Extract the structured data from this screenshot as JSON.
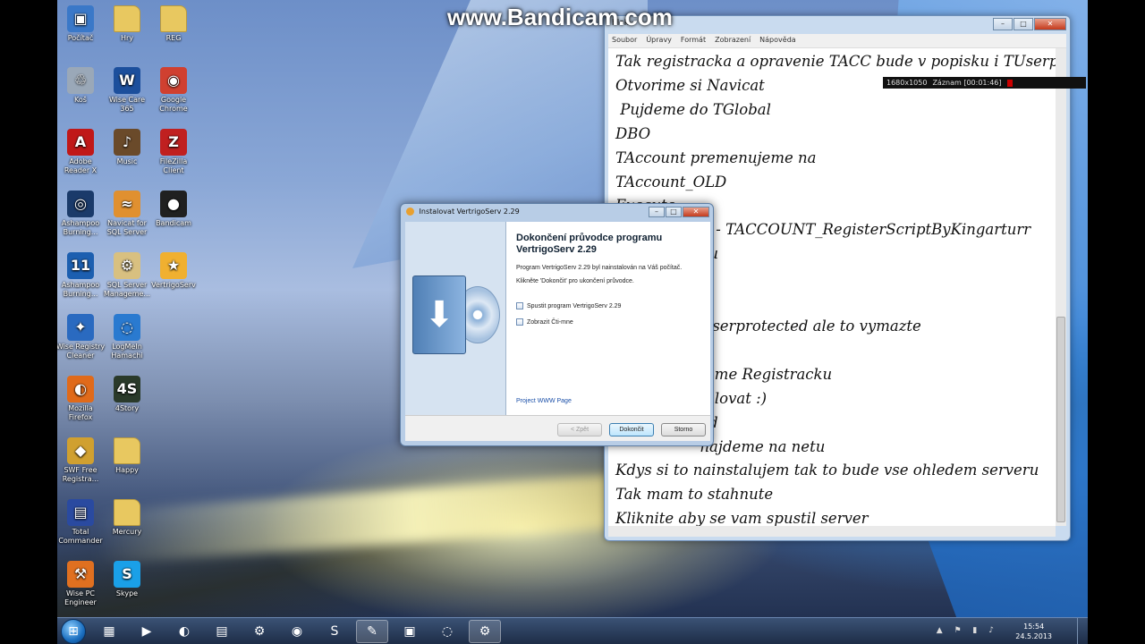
{
  "watermark": "www.Bandicam.com",
  "recorder": {
    "resolution": "1680x1050",
    "status": "Záznam [00:01:46]"
  },
  "desktop_icons": [
    {
      "label": "Počítač",
      "icon": "computer-icon",
      "color": "#3a78c8",
      "glyph": "▣"
    },
    {
      "label": "Hry",
      "icon": "folder-icon",
      "color": "#e8c860",
      "glyph": ""
    },
    {
      "label": "REG",
      "icon": "folder-icon",
      "color": "#e8c860",
      "glyph": ""
    },
    {
      "label": "Koš",
      "icon": "recycle-bin-icon",
      "color": "#9aa8b8",
      "glyph": "♲"
    },
    {
      "label": "Wise Care 365",
      "icon": "wise-care-icon",
      "color": "#1c4f9c",
      "glyph": "W"
    },
    {
      "label": "Google Chrome",
      "icon": "chrome-icon",
      "color": "#d04030",
      "glyph": "◉"
    },
    {
      "label": "Adobe Reader X",
      "icon": "adobe-reader-icon",
      "color": "#c01818",
      "glyph": "A"
    },
    {
      "label": "Music",
      "icon": "music-folder-icon",
      "color": "#6a4a2a",
      "glyph": "♪"
    },
    {
      "label": "FileZilla Client",
      "icon": "filezilla-icon",
      "color": "#c02020",
      "glyph": "Z"
    },
    {
      "label": "Ashampoo Burning...",
      "icon": "ashampoo-icon",
      "color": "#1a3a6a",
      "glyph": "◎"
    },
    {
      "label": "Navicat for SQL Server",
      "icon": "navicat-icon",
      "color": "#e09030",
      "glyph": "≈"
    },
    {
      "label": "Bandicam",
      "icon": "bandicam-icon",
      "color": "#202020",
      "glyph": "●"
    },
    {
      "label": "Ashampoo Burning...",
      "icon": "ashampoo-11-icon",
      "color": "#1c5fb0",
      "glyph": "11"
    },
    {
      "label": "SQL Server Manageme...",
      "icon": "sql-server-icon",
      "color": "#d8c080",
      "glyph": "⚙"
    },
    {
      "label": "VertrigoServ",
      "icon": "vertrigoserv-icon",
      "color": "#f0b030",
      "glyph": "★"
    },
    {
      "label": "Wise Registry Cleaner",
      "icon": "wise-registry-icon",
      "color": "#2a6ac0",
      "glyph": "✦"
    },
    {
      "label": "LogMeIn Hamachi",
      "icon": "hamachi-icon",
      "color": "#2a7ad0",
      "glyph": "◌"
    },
    {
      "label": "",
      "icon": "blank",
      "color": "transparent",
      "glyph": ""
    },
    {
      "label": "Mozilla Firefox",
      "icon": "firefox-icon",
      "color": "#e06a1a",
      "glyph": "◐"
    },
    {
      "label": "4Story",
      "icon": "4story-icon",
      "color": "#2a3a2a",
      "glyph": "4S"
    },
    {
      "label": "",
      "icon": "blank",
      "color": "transparent",
      "glyph": ""
    },
    {
      "label": "SWF Free Registra...",
      "icon": "swf-registration-icon",
      "color": "#d0a030",
      "glyph": "◆"
    },
    {
      "label": "Happy",
      "icon": "folder-icon",
      "color": "#e8c860",
      "glyph": ""
    },
    {
      "label": "",
      "icon": "blank",
      "color": "transparent",
      "glyph": ""
    },
    {
      "label": "Total Commander",
      "icon": "total-commander-icon",
      "color": "#2a4aa0",
      "glyph": "▤"
    },
    {
      "label": "Mercury",
      "icon": "folder-icon",
      "color": "#e8c860",
      "glyph": ""
    },
    {
      "label": "",
      "icon": "blank",
      "color": "transparent",
      "glyph": ""
    },
    {
      "label": "Wise PC Engineer",
      "icon": "wise-pc-engineer-icon",
      "color": "#e07020",
      "glyph": "⚒"
    },
    {
      "label": "Skype",
      "icon": "skype-icon",
      "color": "#1aa0e8",
      "glyph": "S"
    }
  ],
  "notepad": {
    "title": "blok",
    "menu": [
      "Soubor",
      "Úpravy",
      "Formát",
      "Zobrazení",
      "Nápověda"
    ],
    "lines": [
      "Tak registracka a opravenie TACC bude v popisku i TUserprote",
      "Otvorime si Navicat",
      " Pujdeme do TGlobal",
      "DBO",
      "TAccount premenujeme na",
      "TAccount_OLD",
      "Execute",
      "                  C - TACCOUNT_RegisterScriptByKingarturr",
      "                  ou",
      "",
      "",
      "                  Userprotected ale to vymazte",
      "",
      "                  teme Registracku",
      "                  talovat :)",
      "                  ed",
      "                  najdeme na netu",
      "Kdys si to nainstalujem tak to bude vse ohledem serveru",
      "Tak mam to stahnute",
      "Kliknite aby se vam spustil server"
    ]
  },
  "installer": {
    "title": "Instalovat VertrigoServ 2.29",
    "heading": "Dokončení průvodce programu VertrigoServ 2.29",
    "message1": "Program VertrigoServ 2.29 byl nainstalován na Váš počítač.",
    "message2": "Klikněte 'Dokončit' pro ukončení průvodce.",
    "checkbox1": "Spustit program VertrigoServ 2.29",
    "checkbox2": "Zobrazit Čti-mne",
    "link": "Project WWW Page",
    "back_label": "< Zpět",
    "finish_label": "Dokončit",
    "cancel_label": "Storno"
  },
  "taskbar": {
    "time": "15:54",
    "date": "24.5.2013",
    "apps": [
      {
        "name": "explorer",
        "glyph": "▦",
        "active": false
      },
      {
        "name": "media-player",
        "glyph": "▶",
        "active": false
      },
      {
        "name": "firefox",
        "glyph": "◐",
        "active": false
      },
      {
        "name": "total-commander",
        "glyph": "▤",
        "active": false
      },
      {
        "name": "settings",
        "glyph": "⚙",
        "active": false
      },
      {
        "name": "chrome",
        "glyph": "◉",
        "active": false
      },
      {
        "name": "skype",
        "glyph": "S",
        "active": false
      },
      {
        "name": "notepad",
        "glyph": "✎",
        "active": true
      },
      {
        "name": "network",
        "glyph": "▣",
        "active": false
      },
      {
        "name": "hamachi",
        "glyph": "◌",
        "active": false
      },
      {
        "name": "installer",
        "glyph": "⚙",
        "active": true
      }
    ]
  }
}
